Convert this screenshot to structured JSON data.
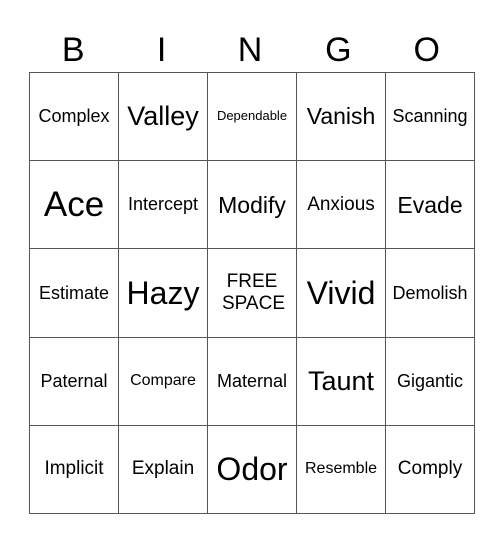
{
  "header": [
    "B",
    "I",
    "N",
    "G",
    "O"
  ],
  "rows": [
    [
      "Complex",
      "Valley",
      "Dependable",
      "Vanish",
      "Scanning"
    ],
    [
      "Ace",
      "Intercept",
      "Modify",
      "Anxious",
      "Evade"
    ],
    [
      "Estimate",
      "Hazy",
      "FREE SPACE",
      "Vivid",
      "Demolish"
    ],
    [
      "Paternal",
      "Compare",
      "Maternal",
      "Taunt",
      "Gigantic"
    ],
    [
      "Implicit",
      "Explain",
      "Odor",
      "Resemble",
      "Comply"
    ]
  ]
}
